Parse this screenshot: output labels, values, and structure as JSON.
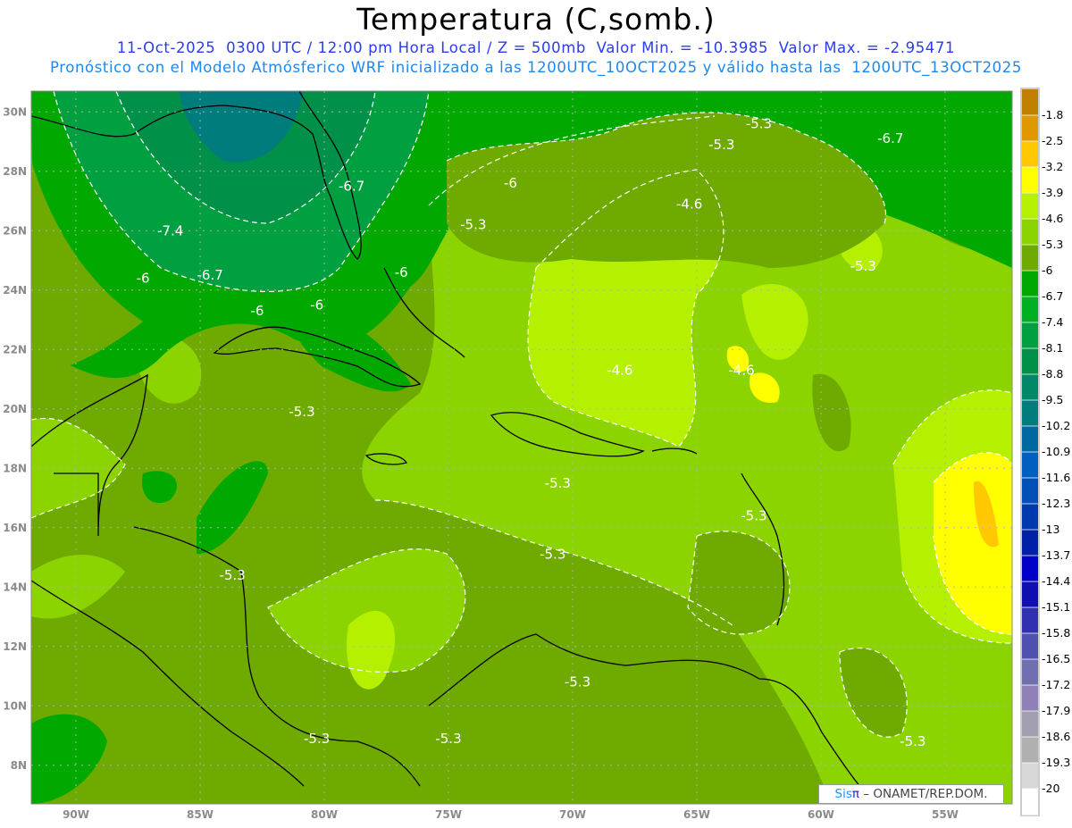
{
  "header": {
    "title": "Temperatura (C,somb.)",
    "line1": "11-Oct-2025  0300 UTC / 12:00 pm Hora Local / Z = 500mb  Valor Min. = -10.3985  Valor Max. = -2.95471",
    "line2": "Pronóstico con el Modelo Atmósferico WRF inicializado a las 1200UTC_10OCT2025 y válido hasta las  1200UTC_13OCT2025"
  },
  "map": {
    "lon_range": [
      -91.8,
      -52.3
    ],
    "lat_range": [
      6.7,
      30.7
    ],
    "lon_ticks": [
      {
        "v": -90,
        "label": "90W"
      },
      {
        "v": -85,
        "label": "85W"
      },
      {
        "v": -80,
        "label": "80W"
      },
      {
        "v": -75,
        "label": "75W"
      },
      {
        "v": -70,
        "label": "70W"
      },
      {
        "v": -65,
        "label": "65W"
      },
      {
        "v": -60,
        "label": "60W"
      },
      {
        "v": -55,
        "label": "55W"
      }
    ],
    "lat_ticks": [
      {
        "v": 30,
        "label": "30N"
      },
      {
        "v": 28,
        "label": "28N"
      },
      {
        "v": 26,
        "label": "26N"
      },
      {
        "v": 24,
        "label": "24N"
      },
      {
        "v": 22,
        "label": "22N"
      },
      {
        "v": 20,
        "label": "20N"
      },
      {
        "v": 18,
        "label": "18N"
      },
      {
        "v": 16,
        "label": "16N"
      },
      {
        "v": 14,
        "label": "14N"
      },
      {
        "v": 12,
        "label": "12N"
      },
      {
        "v": 10,
        "label": "10N"
      },
      {
        "v": 8,
        "label": "8N"
      }
    ],
    "contour_labels": [
      {
        "lon": -62.5,
        "lat": 29.6,
        "text": "-5.3"
      },
      {
        "lon": -64,
        "lat": 28.9,
        "text": "-5.3"
      },
      {
        "lon": -57.2,
        "lat": 29.1,
        "text": "-6.7"
      },
      {
        "lon": -72.5,
        "lat": 27.6,
        "text": "-6"
      },
      {
        "lon": -78.9,
        "lat": 27.5,
        "text": "-6.7"
      },
      {
        "lon": -65.3,
        "lat": 26.9,
        "text": "-4.6"
      },
      {
        "lon": -86.2,
        "lat": 26.0,
        "text": "-7.4"
      },
      {
        "lon": -74,
        "lat": 26.2,
        "text": "-5.3"
      },
      {
        "lon": -58.3,
        "lat": 24.8,
        "text": "-5.3"
      },
      {
        "lon": -87.3,
        "lat": 24.4,
        "text": "-6"
      },
      {
        "lon": -84.6,
        "lat": 24.5,
        "text": "-6.7"
      },
      {
        "lon": -76.9,
        "lat": 24.6,
        "text": "-6"
      },
      {
        "lon": -82.7,
        "lat": 23.3,
        "text": "-6"
      },
      {
        "lon": -80.3,
        "lat": 23.5,
        "text": "-6"
      },
      {
        "lon": -68.1,
        "lat": 21.3,
        "text": "-4.6"
      },
      {
        "lon": -63.2,
        "lat": 21.3,
        "text": "-4.6"
      },
      {
        "lon": -80.9,
        "lat": 19.9,
        "text": "-5.3"
      },
      {
        "lon": -70.6,
        "lat": 17.5,
        "text": "-5.3"
      },
      {
        "lon": -62.7,
        "lat": 16.4,
        "text": "-5.3"
      },
      {
        "lon": -70.8,
        "lat": 15.1,
        "text": "-5.3"
      },
      {
        "lon": -83.7,
        "lat": 14.4,
        "text": "-5.3"
      },
      {
        "lon": -69.8,
        "lat": 10.8,
        "text": "-5.3"
      },
      {
        "lon": -80.3,
        "lat": 8.9,
        "text": "-5.3"
      },
      {
        "lon": -75,
        "lat": 8.9,
        "text": "-5.3"
      },
      {
        "lon": -56.3,
        "lat": 8.8,
        "text": "-5.3"
      }
    ]
  },
  "colorbar": {
    "labels": [
      "-1.8",
      "-2.5",
      "-3.2",
      "-3.9",
      "-4.6",
      "-5.3",
      "-6",
      "-6.7",
      "-7.4",
      "-8.1",
      "-8.8",
      "-9.5",
      "-10.2",
      "-10.9",
      "-11.6",
      "-12.3",
      "-13",
      "-13.7",
      "-14.4",
      "-15.1",
      "-15.8",
      "-16.5",
      "-17.2",
      "-17.9",
      "-18.6",
      "-19.3",
      "-20"
    ],
    "colors": [
      "#c08000",
      "#e09800",
      "#ffc800",
      "#ffff00",
      "#b4f000",
      "#8cd400",
      "#6eaa00",
      "#00a800",
      "#00b020",
      "#00a040",
      "#009048",
      "#008868",
      "#007c7c",
      "#0068a0",
      "#0060c0",
      "#0050b8",
      "#0038b0",
      "#0020a8",
      "#0000c8",
      "#1010b0",
      "#3030b0",
      "#5050b0",
      "#7070b0",
      "#9080b8",
      "#a0a0b0",
      "#b0b0b0",
      "#d8d8d8",
      "#ffffff"
    ]
  },
  "credit": {
    "sis": "Sis",
    "pi": "π",
    "rest": " – ONAMET/REP.DOM."
  }
}
